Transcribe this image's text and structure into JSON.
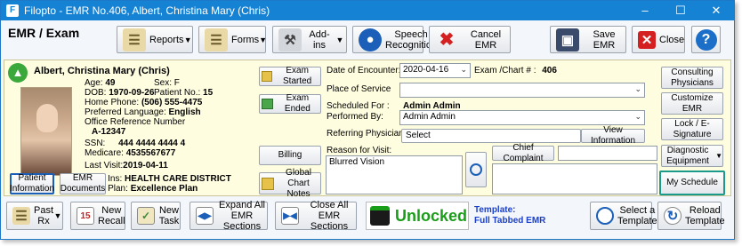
{
  "window": {
    "title": "Filopto - EMR No.406, Albert, Christina Mary (Chris)"
  },
  "header": {
    "page_title": "EMR / Exam",
    "reports_label": "Reports",
    "forms_label": "Forms",
    "addins_label": "Add-ins",
    "speech_label": "Speech Recognition",
    "cancel_label": "Cancel EMR",
    "save_label": "Save EMR",
    "close_label": "Close",
    "help_label": "?"
  },
  "patient": {
    "name": "Albert, Christina Mary (Chris)",
    "age_label": "Age:",
    "age": "49",
    "sex_label": "Sex:",
    "sex": "F",
    "dob_label": "DOB:",
    "dob": "1970-09-26",
    "patient_no_label": "Patient No.:",
    "patient_no": "15",
    "home_phone_label": "Home Phone:",
    "home_phone": "(506) 555-4475",
    "language_label": "Preferred Language:",
    "language": "English",
    "office_ref_label": "Office Reference Number",
    "office_ref": "A-12347",
    "ssn_label": "SSN:",
    "ssn": "444 4444 4444 4",
    "medicare_label": "Medicare:",
    "medicare": "4535567677",
    "last_visit_label": "Last Visit:",
    "last_visit": "2019-04-11",
    "prim_ins_label": "Prim. Ins:",
    "prim_ins": "HEALTH CARE DISTRICT",
    "prim_plan_label": "Prim. Plan:",
    "prim_plan": "Excellence Plan"
  },
  "patient_buttons": {
    "patient_info": "Patient Information",
    "emr_docs": "EMR Documents"
  },
  "exam_buttons": {
    "exam_started": "Exam Started",
    "exam_ended": "Exam Ended",
    "billing": "Billing",
    "global_notes": "Global Chart Notes"
  },
  "encounter": {
    "date_label": "Date of Encounter:",
    "date_value": "2020-04-16",
    "chart_label": "Exam /Chart # :",
    "chart_value": "406",
    "place_label": "Place of Service",
    "place_value": "",
    "scheduled_label": "Scheduled For :",
    "scheduled_value": "Admin Admin",
    "performed_label": "Performed By:",
    "performed_value": "Admin  Admin",
    "referring_label": "Referring Physician",
    "select_label": "Select",
    "view_info_label": "View Information",
    "reason_label": "Reason for Visit:",
    "reason_value": "Blurred Vision",
    "chief_complaint_label": "Chief Complaint",
    "chief_complaint_value": ""
  },
  "side_buttons": {
    "consulting": "Consulting Physicians",
    "customize": "Customize EMR",
    "lock": "Lock / E-Signature",
    "diagnostic": "Diagnostic Equipment",
    "schedule": "My Schedule"
  },
  "footer": {
    "past_rx": "Past Rx",
    "new_recall": "New Recall",
    "new_task": "New Task",
    "expand_all": "Expand All EMR Sections",
    "close_all": "Close All EMR Sections",
    "lock_status": "Unlocked",
    "template_label": "Template:",
    "template_value": "Full Tabbed EMR",
    "select_template": "Select a Template",
    "reload_template": "Reload Template"
  },
  "colors": {
    "title_bar": "#1682d4",
    "panel_bg": "#fffde0",
    "unlocked": "#1a9e1a",
    "template_text": "#1a3fc9"
  }
}
